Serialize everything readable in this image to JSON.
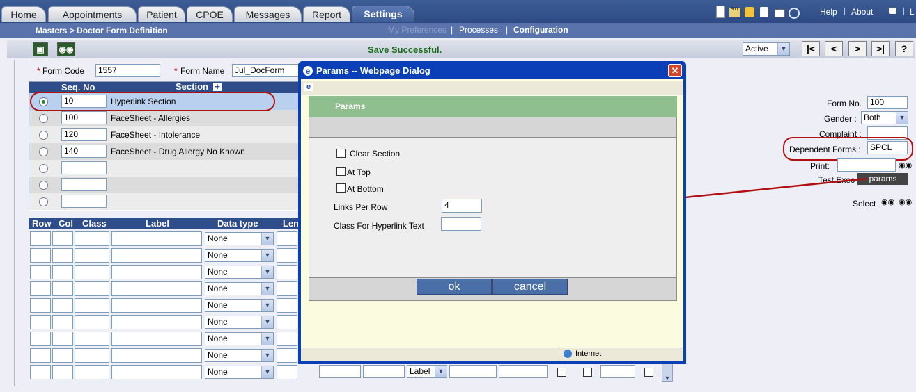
{
  "tabs": [
    {
      "label": "Home"
    },
    {
      "label": "Appointments"
    },
    {
      "label": "Patient"
    },
    {
      "label": "CPOE"
    },
    {
      "label": "Messages"
    },
    {
      "label": "Report"
    },
    {
      "label": "Settings"
    }
  ],
  "top_links": {
    "help": "Help",
    "about": "About",
    "logout_partial": "L"
  },
  "breadcrumb": "Masters > Doctor Form Definition",
  "subnav": {
    "my_preferences": "My Preferences",
    "processes": "Processes",
    "configuration": "Configuration"
  },
  "status_message": "Save Successful.",
  "status_select": "Active",
  "nav_buttons": [
    "|<",
    "<",
    ">",
    ">|",
    "?"
  ],
  "form": {
    "code_label": "Form Code",
    "code_value": "1557",
    "name_label": "Form Name",
    "name_value": "Jul_DocForm"
  },
  "sections_table": {
    "col_seq": "Seq. No",
    "col_section": "Section",
    "rows": [
      {
        "seq": "10",
        "section": "Hyperlink Section",
        "selected": true
      },
      {
        "seq": "100",
        "section": "FaceSheet - Allergies",
        "selected": false
      },
      {
        "seq": "120",
        "section": "FaceSheet - Intolerance",
        "selected": false
      },
      {
        "seq": "140",
        "section": "FaceSheet - Drug Allergy No Known",
        "selected": false
      },
      {
        "seq": "",
        "section": "",
        "selected": false
      },
      {
        "seq": "",
        "section": "",
        "selected": false
      },
      {
        "seq": "",
        "section": "",
        "selected": false
      }
    ]
  },
  "fields_table": {
    "headers": [
      "Row",
      "Col",
      "Class",
      "Label",
      "Data type",
      "Len"
    ],
    "datatype_default": "None",
    "label_type": "Label",
    "row_count": 9
  },
  "right_panel": {
    "form_no_label": "Form No.",
    "form_no_value": "100",
    "gender_label": "Gender :",
    "gender_value": "Both",
    "complaint_label": "Complaint :",
    "dependent_label": "Dependent Forms :",
    "dependent_value": "SPCL",
    "print_label": "Print:",
    "test_exec_label": "Test Exec",
    "params_button": "params",
    "select_label": "Select"
  },
  "dialog": {
    "title": "Params -- Webpage Dialog",
    "header": "Params",
    "clear_section": "Clear Section",
    "at_top": "At Top",
    "at_bottom": "At Bottom",
    "links_per_row_label": "Links Per Row",
    "links_per_row_value": "4",
    "class_label": "Class For Hyperlink Text",
    "class_value": "",
    "ok": "ok",
    "cancel": "cancel",
    "status_zone": "Internet"
  },
  "colors": {
    "header_blue": "#2f4d8a",
    "dialog_blue": "#0a3fb8",
    "green_bar": "#8fbf8f",
    "annotation_red": "#b01010"
  }
}
